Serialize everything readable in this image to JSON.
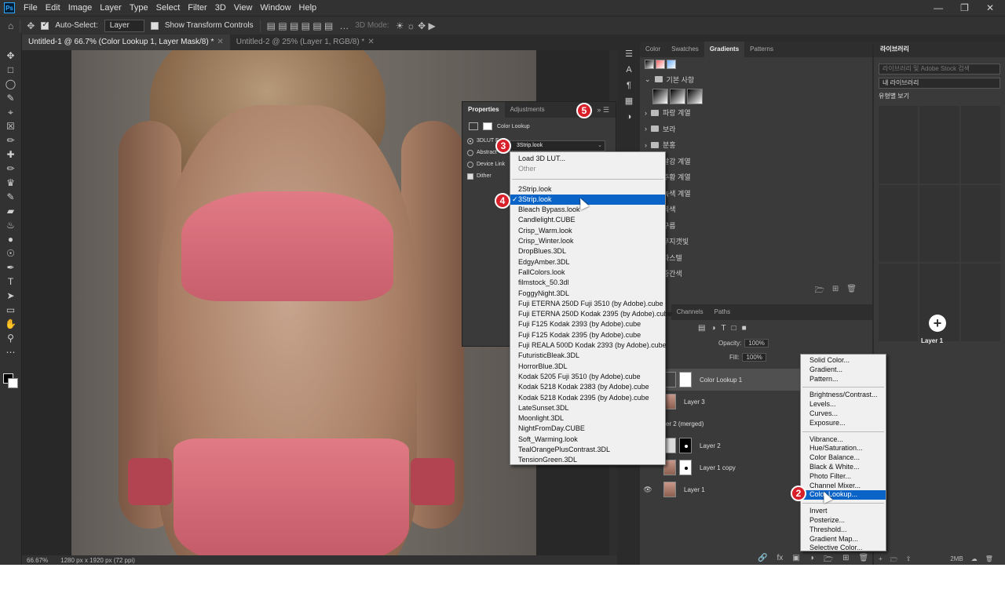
{
  "menubar": {
    "logo": "Ps",
    "items": [
      "File",
      "Edit",
      "Image",
      "Layer",
      "Type",
      "Select",
      "Filter",
      "3D",
      "View",
      "Window",
      "Help"
    ]
  },
  "options": {
    "auto_select": "Auto-Select:",
    "layer_select": "Layer",
    "show_transform": "Show Transform Controls",
    "mode_3d": "3D Mode:"
  },
  "tabs": [
    {
      "label": "Untitled-1 @ 66.7% (Color Lookup 1, Layer Mask/8) *"
    },
    {
      "label": "Untitled-2 @ 25% (Layer 1, RGB/8) *"
    }
  ],
  "status": {
    "zoom": "66.67%",
    "doc_info": "1280 px x 1920 px (72 ppi)"
  },
  "right_tabs": [
    "Color",
    "Swatches",
    "Gradients",
    "Patterns"
  ],
  "gradients": {
    "folders": [
      "기본 사항",
      "파랑 계열",
      "보라",
      "분홍",
      "빨강 계열",
      "주황 계열",
      "녹색 계열",
      "회색",
      "구름",
      "무지갯빛",
      "파스텔",
      "중간색"
    ]
  },
  "layers_panel": {
    "tabs": [
      "Layers",
      "Channels",
      "Paths"
    ],
    "opacity_label": "Opacity:",
    "opacity_value": "100%",
    "fill_label": "Fill:",
    "fill_value": "100%",
    "layers": [
      "Color Lookup 1",
      "Layer 3",
      "Layer 2 (merged)",
      "Layer 2",
      "Layer 1 copy",
      "Layer 1"
    ]
  },
  "library": {
    "title": "라이브러리",
    "search_placeholder": "라이브러리 및 Adobe Stock 검색",
    "selected": "내 라이브러리",
    "view": "유형별 보기",
    "item": "Layer 1",
    "size": "2MB"
  },
  "properties": {
    "tabs": [
      "Properties",
      "Adjustments"
    ],
    "title": "Color Lookup",
    "lut_label": "3DLUT F",
    "abstract": "Abstract",
    "device_link": "Device Link",
    "dither": "Dither",
    "lut_value": "3Strip.look"
  },
  "lut_menu": {
    "top": [
      "Load 3D LUT...",
      "Other"
    ],
    "items": [
      "2Strip.look",
      "3Strip.look",
      "Bleach Bypass.look",
      "Candlelight.CUBE",
      "Crisp_Warm.look",
      "Crisp_Winter.look",
      "DropBlues.3DL",
      "EdgyAmber.3DL",
      "FallColors.look",
      "filmstock_50.3dl",
      "FoggyNight.3DL",
      "Fuji ETERNA 250D Fuji 3510 (by Adobe).cube",
      "Fuji ETERNA 250D Kodak 2395 (by Adobe).cube",
      "Fuji F125 Kodak 2393 (by Adobe).cube",
      "Fuji F125 Kodak 2395 (by Adobe).cube",
      "Fuji REALA 500D Kodak 2393 (by Adobe).cube",
      "FuturisticBleak.3DL",
      "HorrorBlue.3DL",
      "Kodak 5205 Fuji 3510 (by Adobe).cube",
      "Kodak 5218 Kodak 2383 (by Adobe).cube",
      "Kodak 5218 Kodak 2395 (by Adobe).cube",
      "LateSunset.3DL",
      "Moonlight.3DL",
      "NightFromDay.CUBE",
      "Soft_Warming.look",
      "TealOrangePlusContrast.3DL",
      "TensionGreen.3DL"
    ],
    "selected_index": 1
  },
  "adjust_menu": {
    "groups": [
      [
        "Solid Color...",
        "Gradient...",
        "Pattern..."
      ],
      [
        "Brightness/Contrast...",
        "Levels...",
        "Curves...",
        "Exposure..."
      ],
      [
        "Vibrance...",
        "Hue/Saturation...",
        "Color Balance...",
        "Black & White...",
        "Photo Filter...",
        "Channel Mixer...",
        "Color Lookup..."
      ],
      [
        "Invert",
        "Posterize...",
        "Threshold...",
        "Gradient Map...",
        "Selective Color..."
      ]
    ],
    "selected": "Color Lookup..."
  },
  "callouts": [
    "①",
    "2",
    "3",
    "4",
    "5"
  ]
}
